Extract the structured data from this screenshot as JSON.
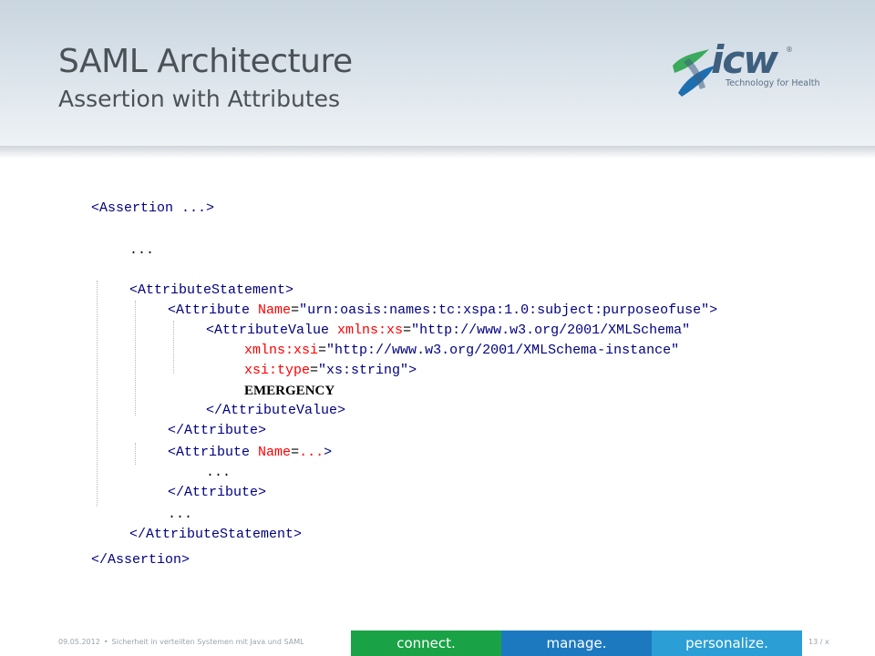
{
  "slide": {
    "title": "SAML Architecture",
    "subtitle": "Assertion with Attributes"
  },
  "logo": {
    "wordmark": "icw",
    "registered": "®",
    "tagline": "Technology for Health",
    "mark_icon": "icw-x-mark-icon",
    "colors": {
      "green": "#3aaa5c",
      "blue": "#1e6fb0",
      "dark": "#3f5f7f"
    }
  },
  "code": {
    "l1_tag": "<Assertion ...>",
    "l2_dots": "...",
    "l3_tag": "<AttributeStatement>",
    "l4_open": "<Attribute ",
    "l4_attr": "Name",
    "l4_eq": "=",
    "l4_val": "\"urn:oasis:names:tc:xspa:1.0:subject:purposeofuse\"",
    "l4_close": ">",
    "l5_open": "<AttributeValue ",
    "l5_attr": "xmlns:xs",
    "l5_eq": "=",
    "l5_val": "\"http://www.w3.org/2001/XMLSchema\"",
    "l6_attr": "xmlns:xsi",
    "l6_eq": "=",
    "l6_val": "\"http://www.w3.org/2001/XMLSchema-instance\"",
    "l7_attr": "xsi:type",
    "l7_eq": "=",
    "l7_val": "\"xs:string\"",
    "l7_close": ">",
    "l8_text": "EMERGENCY",
    "l9_tag": "</AttributeValue>",
    "l10_tag": "</Attribute>",
    "l11_open": "<Attribute ",
    "l11_attr": "Name",
    "l11_eq": "=",
    "l11_val": "...",
    "l11_close": ">",
    "l12_dots": "...",
    "l13_tag": "</Attribute>",
    "l14_dots": "...",
    "l15_tag": "</AttributeStatement>",
    "l16_tag": "</Assertion>",
    "colors": {
      "tag": "#000080",
      "attr": "#ff0000",
      "value": "#000080"
    }
  },
  "footer": {
    "date": "09.05.2012",
    "separator": "•",
    "topic": "Sicherheit in verteilten Systemen mit Java und SAML",
    "page": "13 / x",
    "bars": {
      "connect": "connect.",
      "manage": "manage.",
      "personalize": "personalize."
    },
    "colors": {
      "connect": "#1aa246",
      "manage": "#1c79c0",
      "personalize": "#2b9ed6"
    }
  }
}
